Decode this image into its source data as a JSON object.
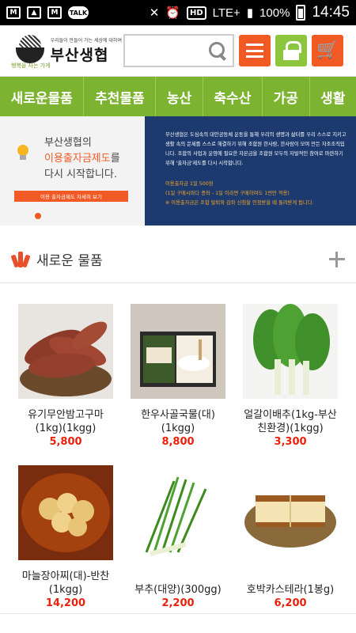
{
  "status_bar": {
    "battery": "100%",
    "time": "14:45",
    "network": "LTE+",
    "hd": "HD",
    "talk": "TALK"
  },
  "header": {
    "logo_subtitle": "우리들이 만들어 가는 세상에 대하여",
    "logo_name": "부산생협",
    "logo_tag": "행복을 사는 가게",
    "search_placeholder": ""
  },
  "nav": {
    "items": [
      "새로운물품",
      "추천물품",
      "농산",
      "축수산",
      "가공",
      "생활"
    ]
  },
  "banner": {
    "line1": "부산생협의",
    "line2_highlight": "이용출자금제도",
    "line2_rest": "를",
    "line3": "다시 시작합니다.",
    "button": "이용 출자금제도 자세히 보기",
    "right_p1": "부산생협은 도심속의 대안공동체 운동을 통해 우리의 생명과 삶터를 우리 스스로 지키고 생활 속의 문제를 스스로 해결하기 위해 조합원 한사람, 한사람이 모여 만든 자조조직입니다. 조합의 사업과 운영에 필요한 자본금을 조합원 모두의 자발적인 참여로 마련하기 위해 '출자금'제도를 다시 시작합니다.",
    "right_p2": "이용출자금 1일 500원",
    "right_p3": "(1일 구매시마다 증좌 - 1일 이라면 구매하여도 1번만 적용)",
    "right_p4": "※ 이용출자금은 조합 탈퇴와 감좌 신청을 인정받을 때 돌려받게 됩니다."
  },
  "section": {
    "title": "새로운 물품"
  },
  "products": [
    {
      "name": "유기무안밤고구마(1kg)(1kgg)",
      "name_l1": "유기무안밤고구마",
      "name_l2": "(1kg)(1kgg)",
      "price": "5,800"
    },
    {
      "name_l1": "한우사골국물(대)",
      "name_l2": "(1kgg)",
      "price": "8,800"
    },
    {
      "name_l1": "얼갈이배추(1kg-부산",
      "name_l2": "친환경)(1kgg)",
      "price": "3,300"
    },
    {
      "name_l1": "마늘장아찌(대)-반찬",
      "name_l2": "(1kgg)",
      "price": "14,200"
    },
    {
      "name_l1": "",
      "name_l2": "부추(대양)(300gg)",
      "price": "2,200"
    },
    {
      "name_l1": "",
      "name_l2": "호박카스테라(1봉g)",
      "price": "6,200"
    }
  ],
  "colors": {
    "accent": "#f15a24",
    "nav": "#7cb331",
    "banner_right": "#1d3a6f",
    "price": "#e8210c"
  }
}
